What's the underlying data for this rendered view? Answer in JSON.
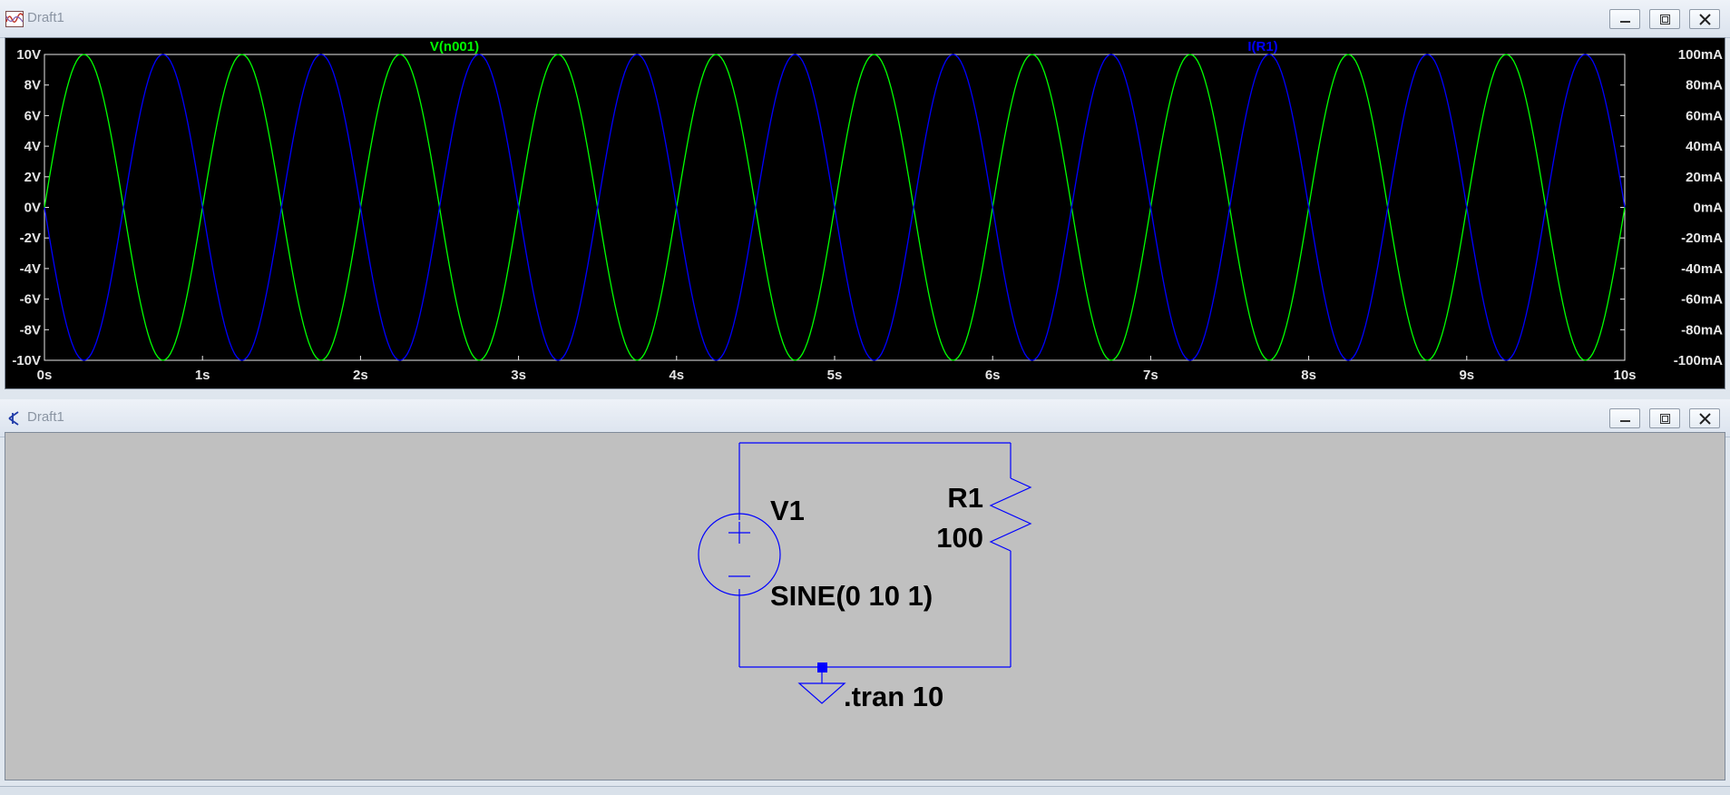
{
  "plot_window": {
    "title": "Draft1",
    "buttons": {
      "minimize": "minimize-icon",
      "maximize": "maximize-icon",
      "close": "close-icon"
    }
  },
  "schematic_window": {
    "title": "Draft1",
    "buttons": {
      "minimize": "minimize-icon",
      "maximize": "maximize-icon",
      "close": "close-icon"
    },
    "components": {
      "source_name": "V1",
      "source_value": "SINE(0 10 1)",
      "resistor_name": "R1",
      "resistor_value": "100",
      "directive": ".tran 10"
    },
    "colors": {
      "wire": "#0000ff",
      "text": "#000000",
      "background": "#c0c0c0"
    }
  },
  "chart_data": {
    "type": "line",
    "title": "",
    "xlabel": "",
    "ylabel": "",
    "x_tick_labels": [
      "0s",
      "1s",
      "2s",
      "3s",
      "4s",
      "5s",
      "6s",
      "7s",
      "8s",
      "9s",
      "10s"
    ],
    "left_tick_labels": [
      "10V",
      "8V",
      "6V",
      "4V",
      "2V",
      "0V",
      "-2V",
      "-4V",
      "-6V",
      "-8V",
      "-10V"
    ],
    "right_tick_labels": [
      "100mA",
      "80mA",
      "60mA",
      "40mA",
      "20mA",
      "0mA",
      "-20mA",
      "-40mA",
      "-60mA",
      "-80mA",
      "-100mA"
    ],
    "xlim": [
      0,
      10
    ],
    "ylim_left": [
      -10,
      10
    ],
    "ylim_right": [
      -100,
      100
    ],
    "grid": false,
    "background": "#000000",
    "series": [
      {
        "name": "V(n001)",
        "axis": "left",
        "color": "#00ff00",
        "function": "10*sin(2*pi*t)",
        "x": [
          0,
          0.25,
          0.5,
          0.75,
          1,
          1.25,
          1.5,
          1.75,
          2,
          2.25,
          2.5,
          2.75,
          3,
          3.25,
          3.5,
          3.75,
          4,
          4.25,
          4.5,
          4.75,
          5,
          5.25,
          5.5,
          5.75,
          6,
          6.25,
          6.5,
          6.75,
          7,
          7.25,
          7.5,
          7.75,
          8,
          8.25,
          8.5,
          8.75,
          9,
          9.25,
          9.5,
          9.75,
          10
        ],
        "values": [
          0,
          10,
          0,
          -10,
          0,
          10,
          0,
          -10,
          0,
          10,
          0,
          -10,
          0,
          10,
          0,
          -10,
          0,
          10,
          0,
          -10,
          0,
          10,
          0,
          -10,
          0,
          10,
          0,
          -10,
          0,
          10,
          0,
          -10,
          0,
          10,
          0,
          -10,
          0,
          10,
          0,
          -10,
          0
        ]
      },
      {
        "name": "I(R1)",
        "axis": "right",
        "color": "#0000ff",
        "function": "-100*sin(2*pi*t)",
        "x": [
          0,
          0.25,
          0.5,
          0.75,
          1,
          1.25,
          1.5,
          1.75,
          2,
          2.25,
          2.5,
          2.75,
          3,
          3.25,
          3.5,
          3.75,
          4,
          4.25,
          4.5,
          4.75,
          5,
          5.25,
          5.5,
          5.75,
          6,
          6.25,
          6.5,
          6.75,
          7,
          7.25,
          7.5,
          7.75,
          8,
          8.25,
          8.5,
          8.75,
          9,
          9.25,
          9.5,
          9.75,
          10
        ],
        "values": [
          0,
          -100,
          0,
          100,
          0,
          -100,
          0,
          100,
          0,
          -100,
          0,
          100,
          0,
          -100,
          0,
          100,
          0,
          -100,
          0,
          100,
          0,
          -100,
          0,
          100,
          0,
          -100,
          0,
          100,
          0,
          -100,
          0,
          100,
          0,
          -100,
          0,
          100,
          0,
          -100,
          0,
          100,
          0
        ]
      }
    ]
  }
}
